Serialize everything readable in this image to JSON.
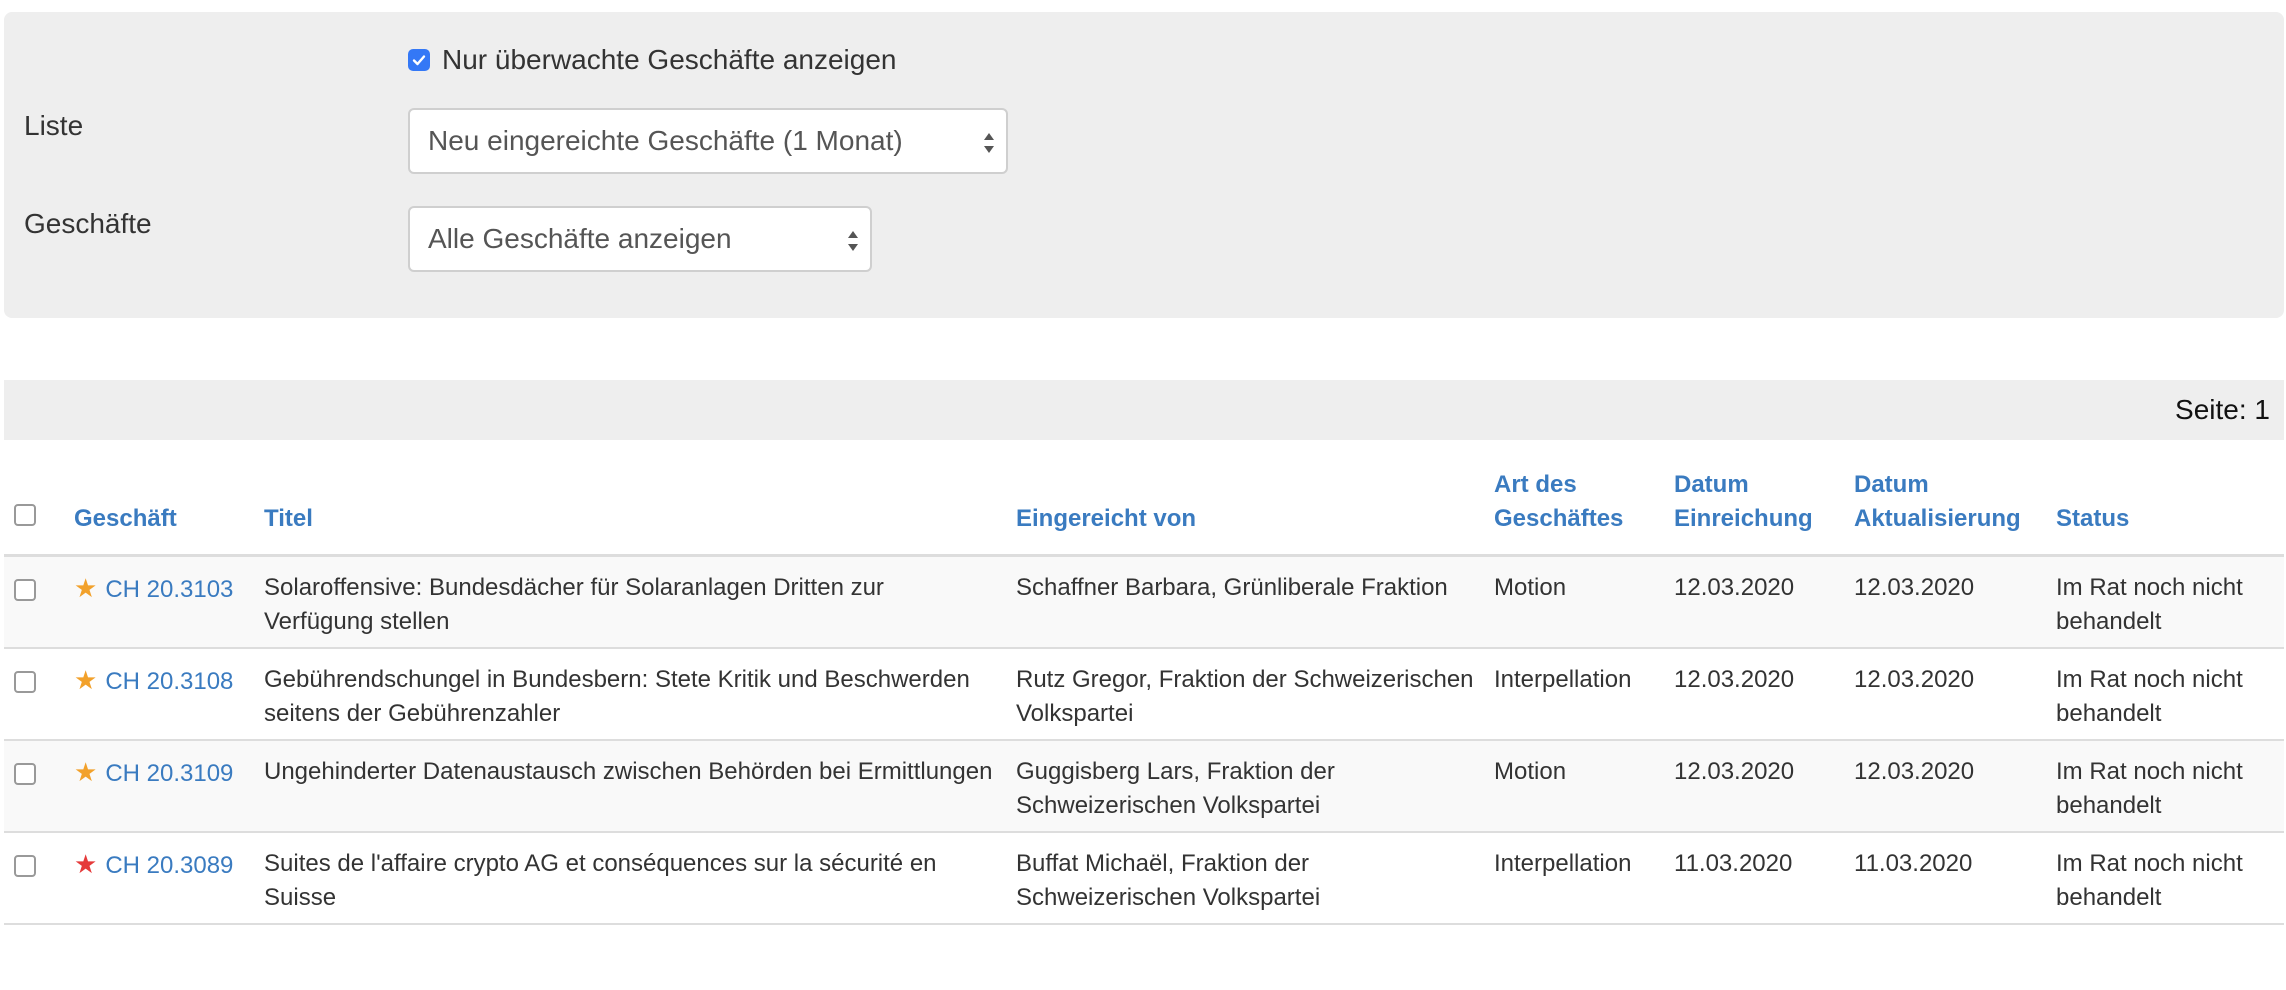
{
  "filters": {
    "watched_only_label": "Nur überwachte Geschäfte anzeigen",
    "watched_only_checked": true,
    "list_label": "Liste",
    "list_value": "Neu eingereichte Geschäfte (1 Monat)",
    "business_label": "Geschäfte",
    "business_value": "Alle Geschäfte anzeigen"
  },
  "pager": {
    "text": "Seite: 1"
  },
  "table": {
    "headers": {
      "geschaeft": "Geschäft",
      "titel": "Titel",
      "eingereicht": "Eingereicht von",
      "art_line1": "Art des",
      "art_line2": "Geschäftes",
      "einreichung_line1": "Datum",
      "einreichung_line2": "Einreichung",
      "aktualisierung_line1": "Datum",
      "aktualisierung_line2": "Aktualisierung",
      "status": "Status"
    },
    "rows": [
      {
        "star_color": "#f2a12b",
        "number": "CH 20.3103",
        "title": "Solaroffensive: Bundesdächer für Solaranlagen Dritten zur Verfügung stellen",
        "submitted_by": "Schaffner Barbara, Grünliberale Fraktion",
        "type": "Motion",
        "date_submitted": "12.03.2020",
        "date_updated": "12.03.2020",
        "status": "Im Rat noch nicht behandelt"
      },
      {
        "star_color": "#f2a12b",
        "number": "CH 20.3108",
        "title": "Gebührendschungel in Bundesbern: Stete Kritik und Beschwerden seitens der Gebührenzahler",
        "submitted_by": "Rutz Gregor, Fraktion der Schweizerischen Volkspartei",
        "type": "Interpellation",
        "date_submitted": "12.03.2020",
        "date_updated": "12.03.2020",
        "status": "Im Rat noch nicht behandelt"
      },
      {
        "star_color": "#f2a12b",
        "number": "CH 20.3109",
        "title": "Ungehinderter Datenaustausch zwischen Behörden bei Ermittlungen",
        "submitted_by": "Guggisberg Lars, Fraktion der Schweizerischen Volkspartei",
        "type": "Motion",
        "date_submitted": "12.03.2020",
        "date_updated": "12.03.2020",
        "status": "Im Rat noch nicht behandelt"
      },
      {
        "star_color": "#e53a3a",
        "number": "CH 20.3089",
        "title": "Suites de l'affaire crypto AG et conséquences sur la sécurité en Suisse",
        "submitted_by": "Buffat Michaël, Fraktion der Schweizerischen Volkspartei",
        "type": "Interpellation",
        "date_submitted": "11.03.2020",
        "date_updated": "11.03.2020",
        "status": "Im Rat noch nicht behandelt"
      }
    ]
  }
}
